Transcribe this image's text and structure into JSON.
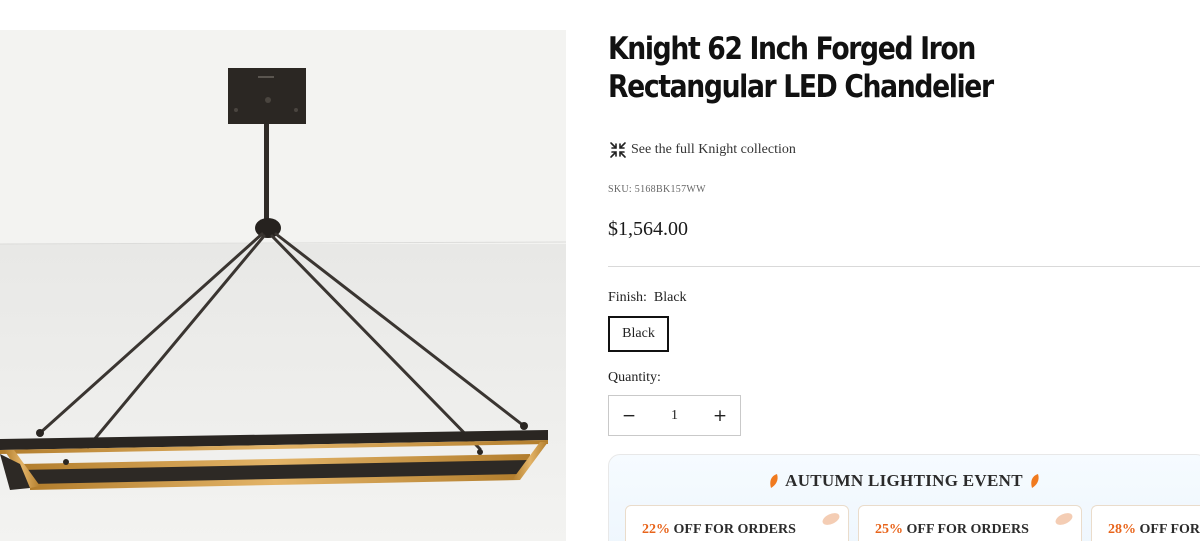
{
  "product": {
    "title": "Knight 62 Inch Forged Iron Rectangular LED Chandelier",
    "collection_link": "See the full Knight collection",
    "sku": "SKU: 5168BK157WW",
    "price": "$1,564.00",
    "finish_label": "Finish:",
    "finish_value": "Black",
    "finish_options": [
      "Black"
    ],
    "quantity_label": "Quantity:",
    "quantity": "1",
    "decrement": "−",
    "increment": "+"
  },
  "promo": {
    "title": "AUTUMN LIGHTING EVENT",
    "offers": [
      {
        "percent": "22%",
        "text": "OFF FOR ORDERS"
      },
      {
        "percent": "25%",
        "text": "OFF FOR ORDERS"
      },
      {
        "percent": "28%",
        "text": "OFF FOR"
      }
    ]
  },
  "icons": {
    "collection": "collapse-arrows-icon",
    "leaf": "autumn-leaf-icon"
  },
  "colors": {
    "accent": "#e8641b",
    "leaf": "#f07a1f",
    "fixture": "#2a2622",
    "led_glow": "#d9a44a"
  }
}
